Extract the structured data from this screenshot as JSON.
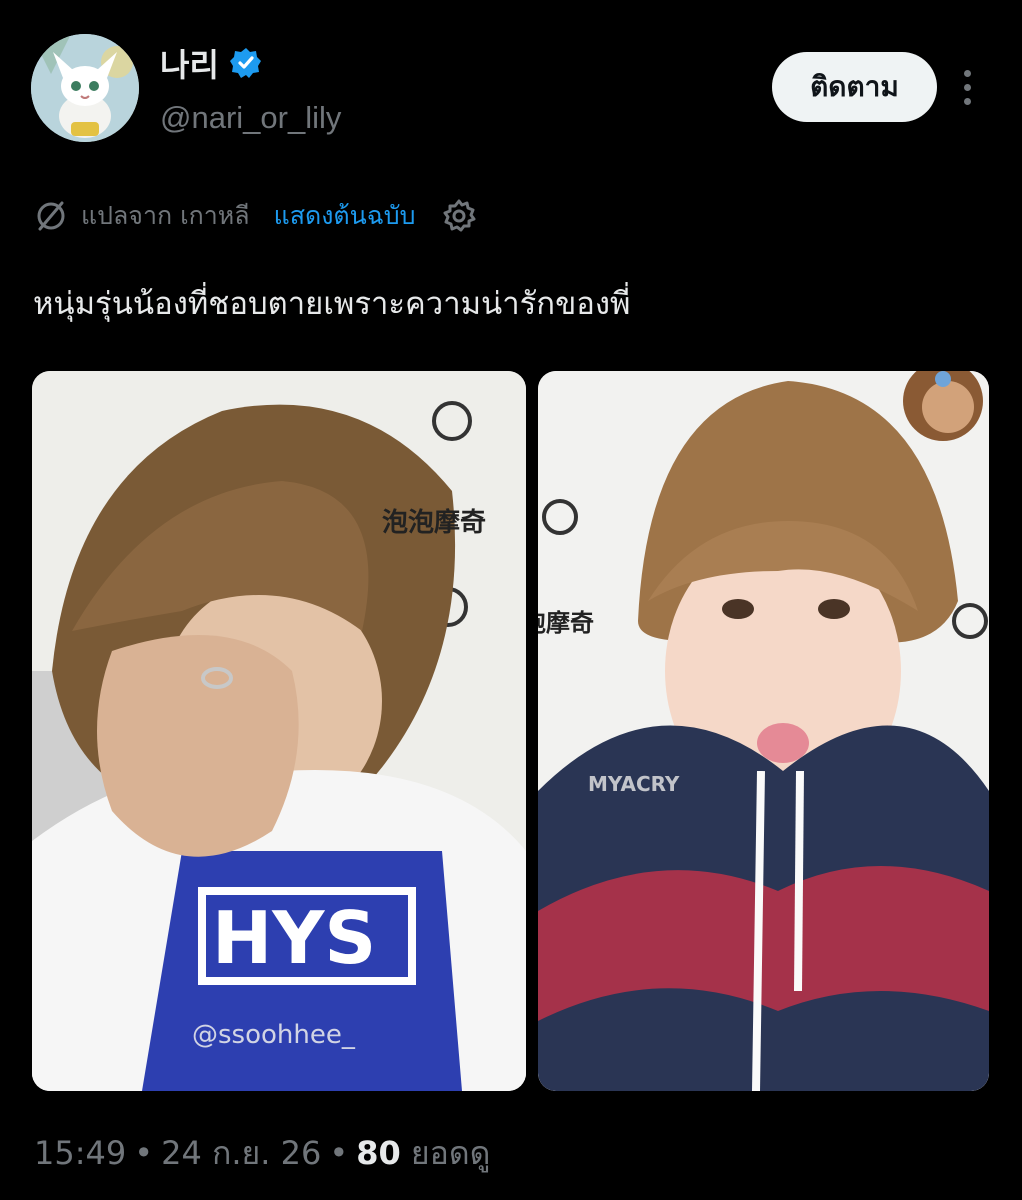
{
  "author": {
    "display_name": "나리",
    "handle": "@nari_or_lily",
    "verified": true,
    "avatar_icon": "white-cat-avatar"
  },
  "actions": {
    "follow_label": "ติดตาม",
    "more_icon": "more-vertical-icon"
  },
  "translation": {
    "translated_from": "แปลจาก เกาหลี",
    "show_original": "แสดงต้นฉบับ",
    "icon": "translate-icon",
    "settings_icon": "gear-icon",
    "link_color": "#1d9bf0"
  },
  "tweet": {
    "text": "หนุ่มรุ่นน้องที่ชอบตายเพราะความน่ารักของพี่"
  },
  "media": {
    "left": {
      "watermark": "@ssoohhee_",
      "shirt_text": "HYS",
      "backdrop_text": "泡泡摩奇"
    },
    "right": {
      "watermark": "MYACRY",
      "backdrop_text": "泡泡摩奇"
    }
  },
  "meta": {
    "time": "15:49",
    "date": "24 ก.ย. 26",
    "views_count": "80",
    "views_label": "ยอดดู",
    "separator": "•"
  }
}
